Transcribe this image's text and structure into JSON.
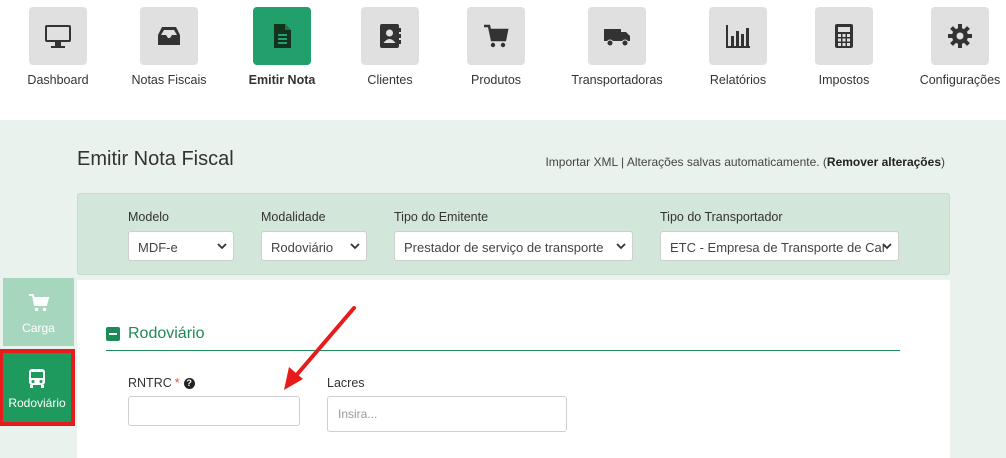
{
  "nav": [
    {
      "label": "Dashboard",
      "icon": "monitor-icon"
    },
    {
      "label": "Notas Fiscais",
      "icon": "inbox-icon"
    },
    {
      "label": "Emitir Nota",
      "icon": "document-icon",
      "active": true
    },
    {
      "label": "Clientes",
      "icon": "address-book-icon"
    },
    {
      "label": "Produtos",
      "icon": "cart-icon"
    },
    {
      "label": "Transportadoras",
      "icon": "truck-icon"
    },
    {
      "label": "Relatórios",
      "icon": "bar-chart-icon"
    },
    {
      "label": "Impostos",
      "icon": "calculator-icon"
    },
    {
      "label": "Configurações",
      "icon": "gear-icon"
    }
  ],
  "page": {
    "title": "Emitir Nota Fiscal",
    "import_xml": "Importar XML",
    "separator": " | ",
    "autosave": "Alterações salvas automaticamente. (",
    "remove_changes": "Remover alterações",
    "close_paren": ")"
  },
  "filters": {
    "modelo": {
      "label": "Modelo",
      "value": "MDF-e"
    },
    "modalidade": {
      "label": "Modalidade",
      "value": "Rodoviário"
    },
    "tipo_emitente": {
      "label": "Tipo do Emitente",
      "value": "Prestador de serviço de transporte"
    },
    "tipo_transportador": {
      "label": "Tipo do Transportador",
      "value": "ETC - Empresa de Transporte de Car"
    }
  },
  "side_tabs": [
    {
      "label": "Carga",
      "icon": "cart-icon"
    },
    {
      "label": "Rodoviário",
      "icon": "bus-icon",
      "active": true
    }
  ],
  "section": {
    "title": "Rodoviário",
    "rntrc": {
      "label": "RNTRC",
      "required": "*",
      "help": "?",
      "value": ""
    },
    "lacres": {
      "label": "Lacres",
      "placeholder": "Insira..."
    }
  },
  "colors": {
    "accent": "#22a06b",
    "accent_dark": "#1e8a57",
    "highlight": "#e61c1c",
    "panel": "#d2e6da",
    "background": "#e9f2ec"
  }
}
